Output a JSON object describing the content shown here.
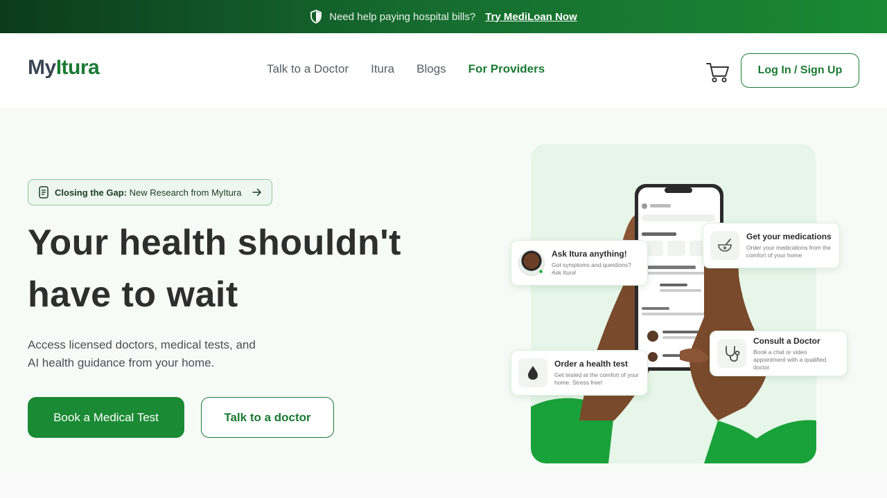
{
  "promo": {
    "text": "Need help paying hospital bills?",
    "link": "Try MediLoan Now"
  },
  "header": {
    "logo_part1": "My",
    "logo_part2": "Itura",
    "nav": [
      "Talk to a Doctor",
      "Itura",
      "Blogs",
      "For Providers"
    ],
    "login_label": "Log In / Sign Up"
  },
  "hero": {
    "research_strong": "Closing the Gap:",
    "research_text": "New Research from MyItura",
    "headline_line1": "Your health shouldn't",
    "headline_line2": "have to wait",
    "subtext_line1": "Access licensed doctors, medical tests, and",
    "subtext_line2": "AI health guidance from your home.",
    "primary_button": "Book a Medical Test",
    "secondary_button": "Talk to a doctor"
  },
  "cards": {
    "ask": {
      "title": "Ask Itura anything!",
      "desc": "Got symptoms and questions? Ask Itura!"
    },
    "meds": {
      "title": "Get your medications",
      "desc": "Order your medications from the comfort of your home"
    },
    "order": {
      "title": "Order a health test",
      "desc": "Get tested at the comfort of your home. Stress free!"
    },
    "doctor": {
      "title": "Consult a Doctor",
      "desc": "Book a chat or video appointment with a qualified doctor"
    }
  },
  "colors": {
    "brand_green": "#1a7a33",
    "button_green": "#1a8a34",
    "promo_dark": "#0c3b1c",
    "logo_dark": "#3a4654"
  },
  "icons": [
    "shield-icon",
    "cart-icon",
    "document-icon",
    "arrow-right-icon",
    "mortar-pestle-icon",
    "drop-icon",
    "stethoscope-icon"
  ]
}
